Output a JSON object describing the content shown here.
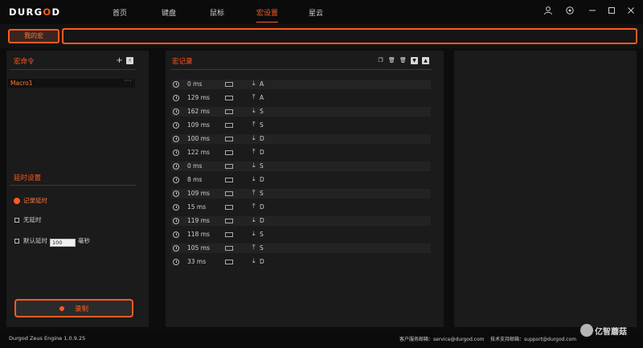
{
  "app": {
    "brand_prefix": "DURG",
    "brand_o": "O",
    "brand_suffix": "D"
  },
  "nav": {
    "items": [
      "首页",
      "键盘",
      "鼠标",
      "宏设置",
      "星云"
    ],
    "active": "宏设置"
  },
  "window_controls": {
    "icons": [
      "user-icon",
      "settings-icon",
      "minimize-icon",
      "maximize-icon",
      "close-icon"
    ]
  },
  "profile": {
    "tab_label": "我的宏",
    "name_value": ""
  },
  "macro_panel": {
    "title": "宏命令",
    "items": [
      {
        "name": "Macro1",
        "menu": "···"
      }
    ]
  },
  "delay_settings": {
    "title": "延时设置",
    "record_delay": "记录延时",
    "no_delay": "无延时",
    "default_delay": "默认延时",
    "default_delay_value": "100",
    "unit": "毫秒"
  },
  "record_button": {
    "label": "录制"
  },
  "records_panel": {
    "title": "宏记录",
    "rows": [
      {
        "ms": "0 ms",
        "dir": "down",
        "key": "A"
      },
      {
        "ms": "129 ms",
        "dir": "up",
        "key": "A"
      },
      {
        "ms": "162 ms",
        "dir": "down",
        "key": "S"
      },
      {
        "ms": "109 ms",
        "dir": "up",
        "key": "S"
      },
      {
        "ms": "100 ms",
        "dir": "down",
        "key": "D"
      },
      {
        "ms": "122 ms",
        "dir": "up",
        "key": "D"
      },
      {
        "ms": "0 ms",
        "dir": "down",
        "key": "S"
      },
      {
        "ms": "8 ms",
        "dir": "down",
        "key": "D"
      },
      {
        "ms": "109 ms",
        "dir": "up",
        "key": "S"
      },
      {
        "ms": "15 ms",
        "dir": "up",
        "key": "D"
      },
      {
        "ms": "119 ms",
        "dir": "down",
        "key": "D"
      },
      {
        "ms": "118 ms",
        "dir": "down",
        "key": "S"
      },
      {
        "ms": "105 ms",
        "dir": "up",
        "key": "S"
      },
      {
        "ms": "33 ms",
        "dir": "down",
        "key": "D"
      }
    ]
  },
  "footer": {
    "version": "Durgod Zeus Engine 1.0.9.25",
    "service_label": "客户服务邮箱：",
    "service_email": "service@durgod.com",
    "support_label": "技术支持邮箱：",
    "support_email": "support@durgod.com"
  },
  "watermark": {
    "text": "亿智蘑菇"
  },
  "colors": {
    "accent": "#ff5a1f",
    "panel": "#1b1b1b",
    "background": "#0d0d0d"
  }
}
